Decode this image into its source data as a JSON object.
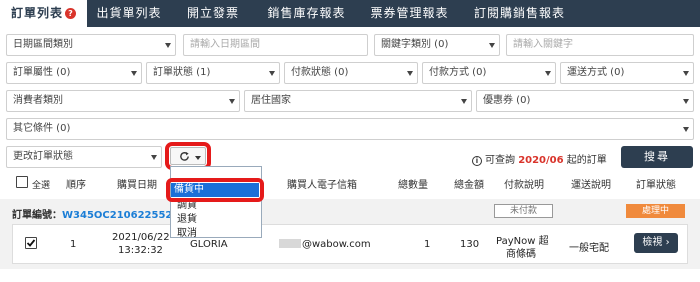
{
  "tabs": [
    {
      "label": "訂單列表",
      "active": true
    },
    {
      "label": "出貨單列表"
    },
    {
      "label": "開立發票"
    },
    {
      "label": "銷售庫存報表"
    },
    {
      "label": "票券管理報表"
    },
    {
      "label": "訂閱購銷售報表"
    }
  ],
  "filters": {
    "date_type": "日期區間類別",
    "date_input_placeholder": "請輸入日期區間",
    "keyword_type": "關鍵字類別 (0)",
    "keyword_placeholder": "請輸入關鍵字",
    "order_attr": "訂單屬性 (0)",
    "order_status": "訂單狀態 (1)",
    "payment_status": "付款狀態 (0)",
    "payment_method": "付款方式 (0)",
    "shipping_method": "運送方式 (0)",
    "consumer_type": "消費者類別",
    "country": "居住國家",
    "coupon": "優惠券 (0)",
    "other": "其它條件 (0)",
    "change_status": "更改訂單狀態"
  },
  "query": {
    "prefix": "可查詢",
    "month": "2020/06",
    "suffix": "起的訂單"
  },
  "search_label": "搜尋",
  "table_headers": {
    "select_all": "全選",
    "seq": "順序",
    "date": "購買日期",
    "email": "購買人電子信箱",
    "qty": "總數量",
    "amount": "總金額",
    "payment": "付款說明",
    "shipping": "運送說明",
    "status": "訂單狀態"
  },
  "status_menu": {
    "selected": "備貨中",
    "items": [
      "調貨",
      "退貨",
      "取消"
    ],
    "visible_partial": "調貨"
  },
  "order": {
    "label": "訂單編號：",
    "id": "W345OC2106225524",
    "payment_badge": "未付款",
    "status_badge": "處理中",
    "seq": "1",
    "date": "2021/06/22",
    "time": "13:32:32",
    "name": "GLORIA",
    "email_domain": "@wabow.com",
    "qty": "1",
    "amount": "130",
    "payment_line1": "PayNow 超",
    "payment_line2": "商條碼",
    "shipping": "一般宅配",
    "view_label": "檢視 ›"
  },
  "colors": {
    "nav": "#2d3e50",
    "highlight": "#e51a1a",
    "accent_red": "#d9342b",
    "link_blue": "#1c7ed6",
    "processing": "#f08a3c"
  }
}
